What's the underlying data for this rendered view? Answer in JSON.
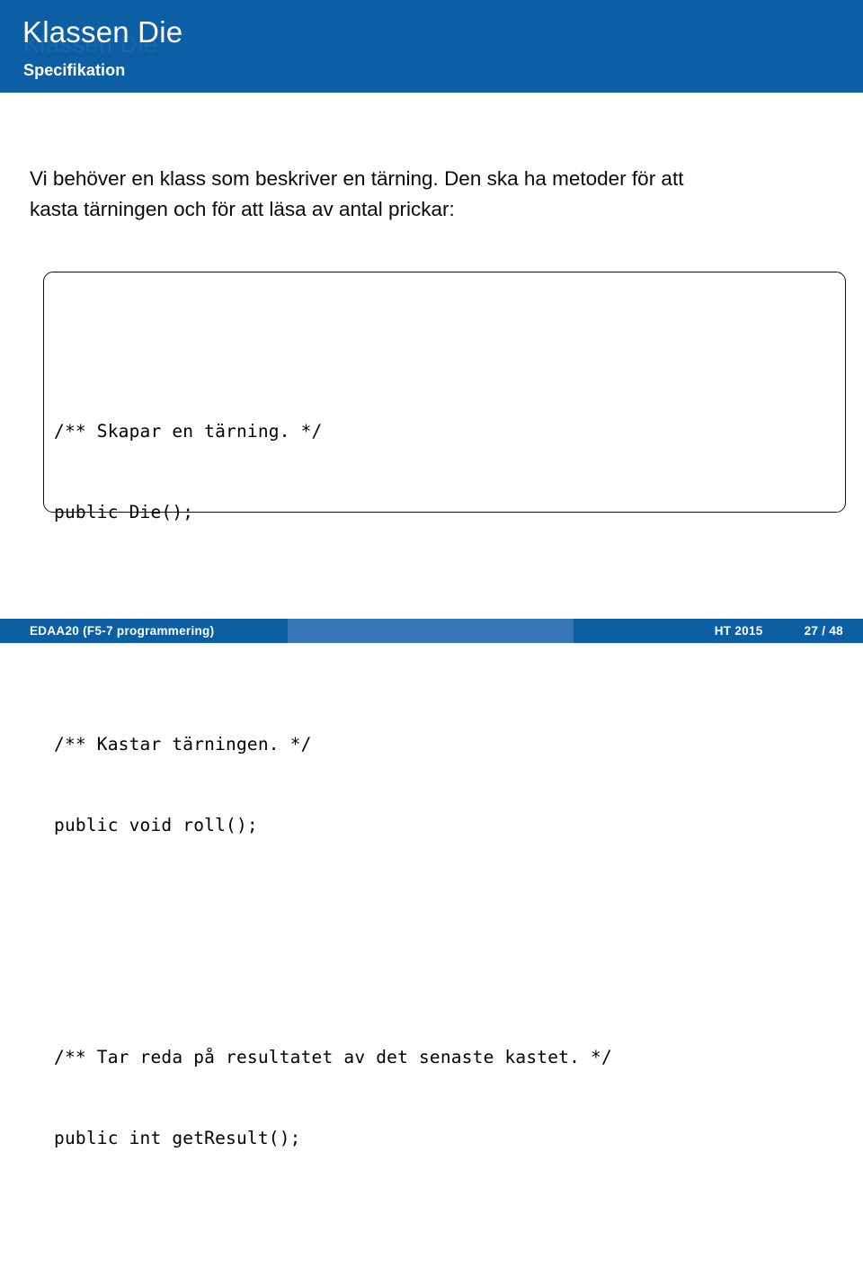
{
  "header": {
    "title": "Klassen Die",
    "subtitle": "Specifikation",
    "watermark": "Klassen Die",
    "bg_color": "#0C5FA5",
    "text_color": "#FFFFFF"
  },
  "body": {
    "intro_line_1": "Vi behöver en klass som beskriver en tärning. Den ska ha metoder för att",
    "intro_line_2": "kasta tärningen och för att läsa av antal prickar:",
    "code_box": {
      "border_color": "#121212",
      "groups": [
        {
          "comment": "/** Skapar en tärning. */",
          "signature": "public Die();"
        },
        {
          "comment": "/** Kastar tärningen. */",
          "signature": "public void roll();"
        },
        {
          "comment": "/** Tar reda på resultatet av det senaste kastet. */",
          "signature": "public int getResult();"
        }
      ]
    }
  },
  "footer": {
    "course": "EDAA20  (F5-7 programmering)",
    "term": "HT 2015",
    "page": "27 / 48",
    "dark_color": "#0C5FA5",
    "light_color": "#3777B8"
  }
}
